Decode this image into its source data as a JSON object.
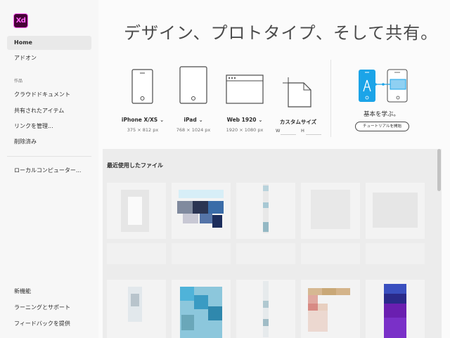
{
  "app": {
    "logo_text": "Xd",
    "headline": "デザイン、プロトタイプ、そして共有。"
  },
  "sidebar": {
    "items_top": [
      {
        "label": "Home",
        "active": true
      },
      {
        "label": "アドオン",
        "active": false
      }
    ],
    "section_title": "作品",
    "items_works": [
      {
        "label": "クラウドドキュメント"
      },
      {
        "label": "共有されたアイテム"
      },
      {
        "label": "リンクを管理..."
      },
      {
        "label": "削除済み"
      }
    ],
    "local": "ローカルコンピューター...",
    "items_bottom": [
      {
        "label": "新機能"
      },
      {
        "label": "ラーニングとサポート"
      },
      {
        "label": "フィードバックを提供"
      }
    ]
  },
  "presets": [
    {
      "name": "iPhone X/XS",
      "size": "375 × 812 px",
      "icon": "phone-icon"
    },
    {
      "name": "iPad",
      "size": "768 × 1024 px",
      "icon": "tablet-icon"
    },
    {
      "name": "Web 1920",
      "size": "1920 × 1080 px",
      "icon": "browser-window-icon"
    },
    {
      "name": "カスタムサイズ",
      "width_label": "W",
      "height_label": "H",
      "icon": "custom-size-icon"
    }
  ],
  "learn": {
    "title": "基本を学ぶ。",
    "button": "チュートリアルを開始"
  },
  "recent": {
    "title": "最近使用したファイル"
  },
  "colors": {
    "accent_blue": "#1ba4e8",
    "xd_bg": "#470137",
    "xd_fg": "#ff61f6"
  }
}
